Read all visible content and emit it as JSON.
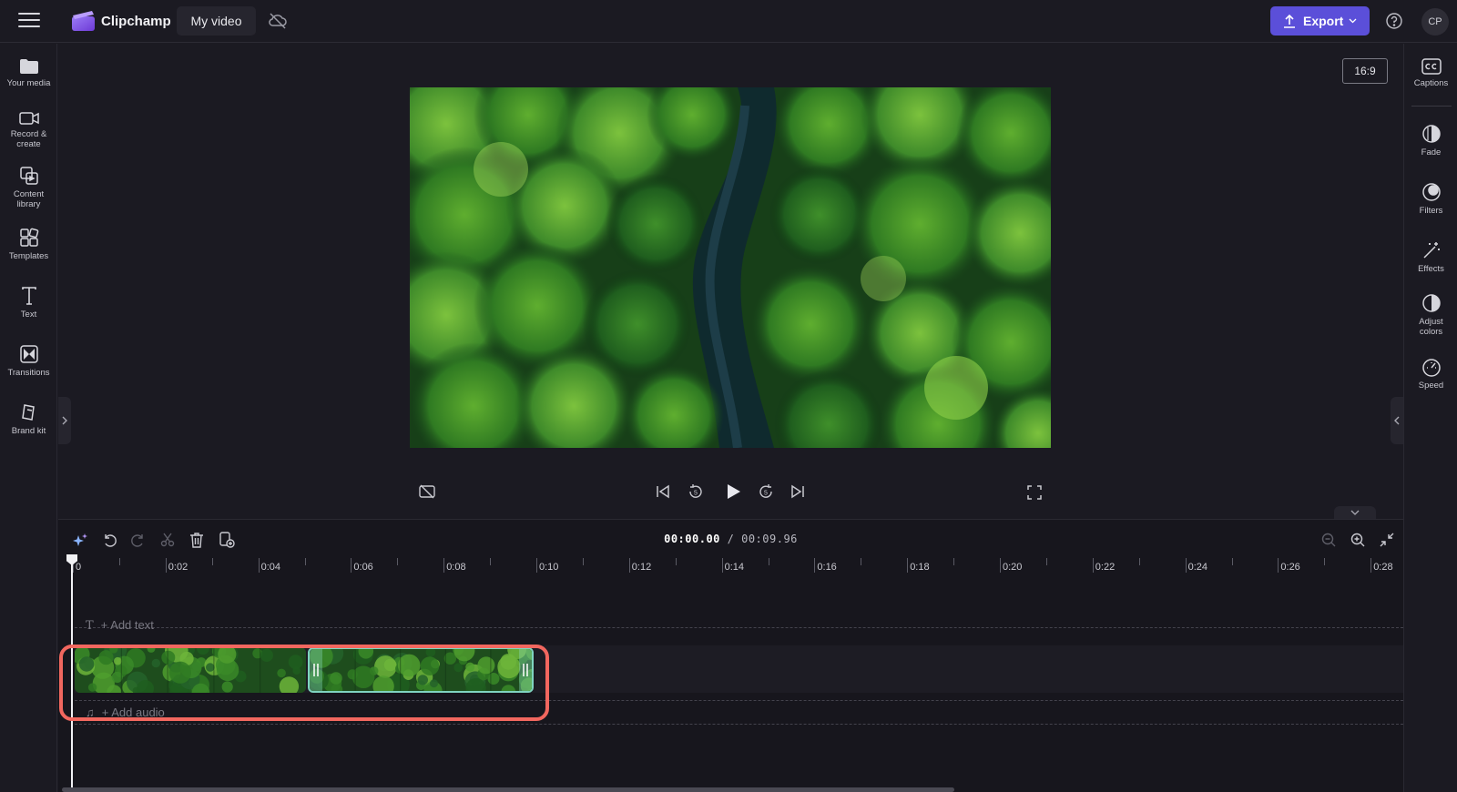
{
  "app": {
    "name": "Clipchamp",
    "project_title": "My video"
  },
  "header": {
    "export_label": "Export",
    "avatar_initials": "CP"
  },
  "left_sidebar": {
    "items": [
      {
        "label": "Your media",
        "icon": "folder-icon"
      },
      {
        "label": "Record & create",
        "icon": "camera-icon"
      },
      {
        "label": "Content library",
        "icon": "library-icon"
      },
      {
        "label": "Templates",
        "icon": "templates-icon"
      },
      {
        "label": "Text",
        "icon": "text-icon"
      },
      {
        "label": "Transitions",
        "icon": "transitions-icon"
      },
      {
        "label": "Brand kit",
        "icon": "brand-kit-icon"
      }
    ]
  },
  "right_sidebar": {
    "items": [
      {
        "label": "Captions",
        "icon": "captions-icon"
      },
      {
        "label": "Fade",
        "icon": "fade-icon"
      },
      {
        "label": "Filters",
        "icon": "filters-icon"
      },
      {
        "label": "Effects",
        "icon": "effects-icon"
      },
      {
        "label": "Adjust colors",
        "icon": "adjust-colors-icon"
      },
      {
        "label": "Speed",
        "icon": "speed-icon"
      }
    ]
  },
  "preview": {
    "aspect_ratio": "16:9"
  },
  "timeline": {
    "current_time": "00:00.00",
    "separator": " / ",
    "total_time": "00:09.96",
    "ruler_labels": [
      "0",
      "0:02",
      "0:04",
      "0:06",
      "0:08",
      "0:10",
      "0:12",
      "0:14",
      "0:16",
      "0:18",
      "0:20",
      "0:22",
      "0:24",
      "0:26",
      "0:28"
    ],
    "add_text_label": "+ Add text",
    "add_audio_label": "+ Add audio",
    "clips": [
      {
        "duration_seconds": 5.0,
        "selected": false
      },
      {
        "duration_seconds": 4.96,
        "selected": true
      }
    ]
  },
  "colors": {
    "accent": "#5b4fd9",
    "highlight": "#f2675f",
    "selected_clip_border": "#7fd4c0",
    "background": "#1b1a22"
  }
}
